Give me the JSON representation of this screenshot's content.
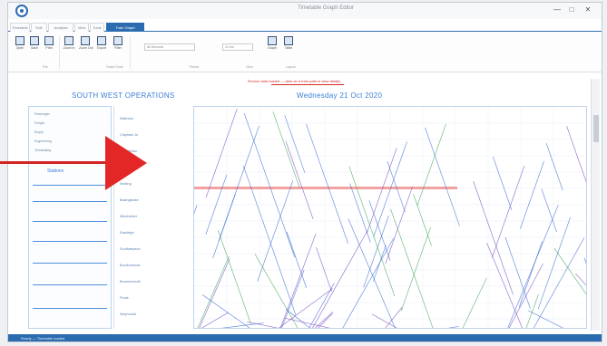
{
  "window": {
    "title": "Timetable Graph Editor",
    "minimize": "—",
    "maximize": "□",
    "close": "✕"
  },
  "tabs": [
    {
      "label": "Timetable"
    },
    {
      "label": "Edit"
    },
    {
      "label": "Analysis"
    },
    {
      "label": "View"
    },
    {
      "label": "Tools"
    },
    {
      "label": "Train Graph"
    }
  ],
  "ribbon": {
    "buttons": [
      {
        "label": "Open",
        "icon": "open-icon"
      },
      {
        "label": "Save",
        "icon": "save-icon"
      },
      {
        "label": "Print",
        "icon": "print-icon"
      },
      {
        "label": "Zoom In",
        "icon": "zoom-in-icon"
      },
      {
        "label": "Zoom Out",
        "icon": "zoom-out-icon"
      },
      {
        "label": "Export",
        "icon": "export-icon"
      },
      {
        "label": "Filter",
        "icon": "filter-icon"
      }
    ],
    "selects": [
      {
        "value": "All Services"
      },
      {
        "value": "24 hrs"
      }
    ],
    "right_buttons": [
      {
        "label": "Graph",
        "icon": "chart-icon"
      },
      {
        "label": "Table",
        "icon": "table-icon"
      }
    ],
    "groups": [
      "File",
      "Graph Tools",
      "Period",
      "View",
      "Layout"
    ]
  },
  "canvas": {
    "banner": "Service data loaded — click on a train path to view details",
    "heading_left": "SOUTH WEST OPERATIONS",
    "heading_right": "Wednesday 21 Oct 2020",
    "legend": [
      "Passenger",
      "Freight",
      "Empty",
      "Engineering",
      "Terminating"
    ],
    "panel_label": "Stations",
    "stations": [
      "Waterloo",
      "Clapham Jn",
      "Wimbledon",
      "Surbiton",
      "Woking",
      "Basingstoke",
      "Winchester",
      "Eastleigh",
      "Southampton",
      "Brockenhurst",
      "Bournemouth",
      "Poole",
      "Weymouth"
    ]
  },
  "status": {
    "text": "Ready — Timetable loaded"
  },
  "colors": {
    "accent": "#2b6cb0",
    "highlight": "#d62828",
    "path_blue": "#3f6fd1",
    "path_purple": "#7b4fc4",
    "path_green": "#45a85c"
  }
}
